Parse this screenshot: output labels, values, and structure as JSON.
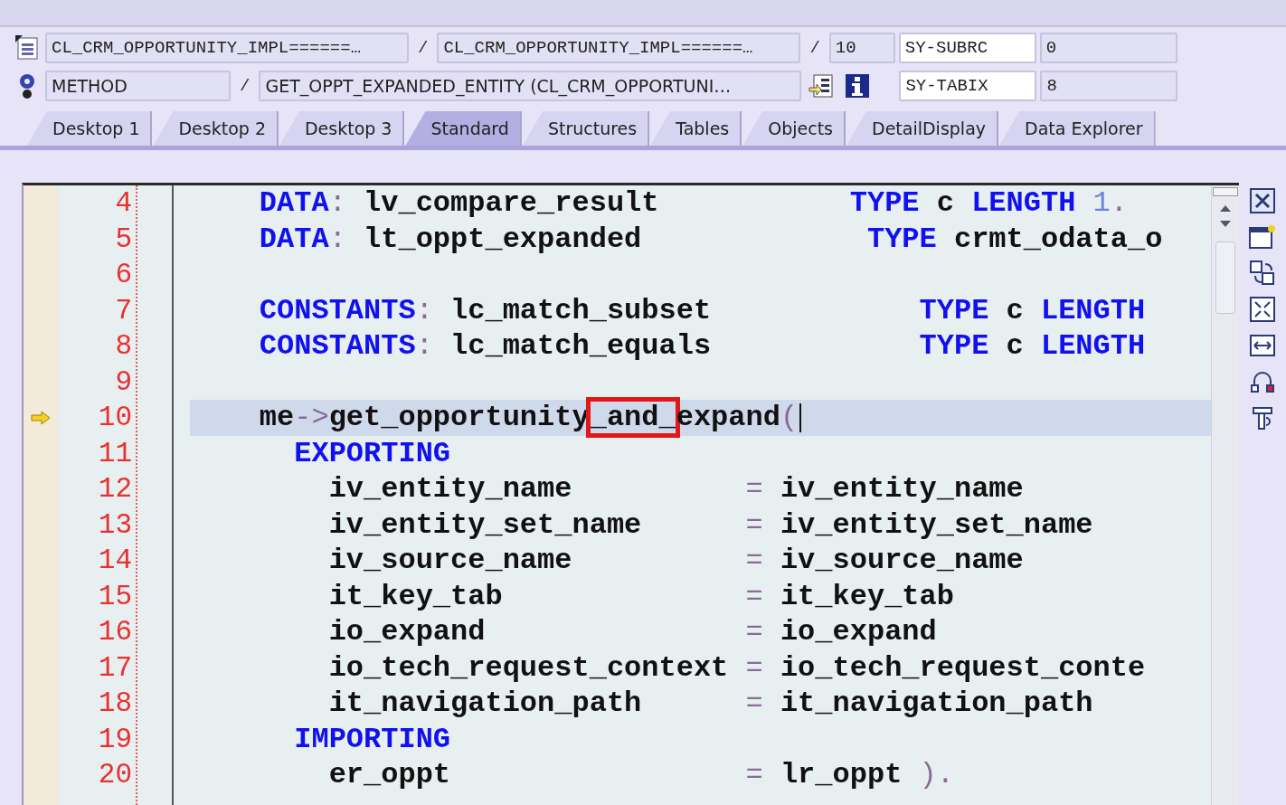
{
  "header_rows": [
    {
      "items": [
        {
          "kind": "mono",
          "value": "CL_CRM_OPPORTUNITY_IMPL======…"
        },
        {
          "kind": "sep",
          "value": "/"
        },
        {
          "kind": "mono",
          "value": "CL_CRM_OPPORTUNITY_IMPL======…"
        },
        {
          "kind": "sep",
          "value": "/"
        },
        {
          "kind": "mono",
          "value": "10"
        },
        {
          "kind": "var",
          "value": "SY-SUBRC"
        },
        {
          "kind": "mono",
          "value": "0"
        }
      ]
    },
    {
      "items": [
        {
          "kind": "sans",
          "value": "METHOD"
        },
        {
          "kind": "sep",
          "value": "/"
        },
        {
          "kind": "sans",
          "value": "GET_OPPT_EXPANDED_ENTITY (CL_CRM_OPPORTUNI…"
        },
        {
          "kind": "tools"
        },
        {
          "kind": "var",
          "value": "SY-TABIX"
        },
        {
          "kind": "mono",
          "value": "8"
        }
      ]
    }
  ],
  "tabs": [
    {
      "label": "Desktop 1",
      "selected": false
    },
    {
      "label": "Desktop 2",
      "selected": false
    },
    {
      "label": "Desktop 3",
      "selected": false
    },
    {
      "label": "Standard",
      "selected": true
    },
    {
      "label": "Structures",
      "selected": false
    },
    {
      "label": "Tables",
      "selected": false
    },
    {
      "label": "Objects",
      "selected": false
    },
    {
      "label": "DetailDisplay",
      "selected": false
    },
    {
      "label": "Data Explorer",
      "selected": false
    }
  ],
  "editor": {
    "lines": [
      {
        "number": "4",
        "current": false,
        "cursor": false,
        "tokens": [
          {
            "kind": "kw",
            "text": "    DATA"
          },
          {
            "kind": "op",
            "text": ":"
          },
          {
            "kind": "id",
            "text": " lv_compare_result           "
          },
          {
            "kind": "kw",
            "text": "TYPE"
          },
          {
            "kind": "id",
            "text": " c "
          },
          {
            "kind": "kw",
            "text": "LENGTH"
          },
          {
            "kind": "num",
            "text": " 1"
          },
          {
            "kind": "op",
            "text": "."
          }
        ]
      },
      {
        "number": "5",
        "current": false,
        "cursor": false,
        "tokens": [
          {
            "kind": "kw",
            "text": "    DATA"
          },
          {
            "kind": "op",
            "text": ":"
          },
          {
            "kind": "id",
            "text": " lt_oppt_expanded             "
          },
          {
            "kind": "kw",
            "text": "TYPE"
          },
          {
            "kind": "id",
            "text": " crmt_odata_o"
          }
        ]
      },
      {
        "number": "6",
        "current": false,
        "cursor": false
      },
      {
        "number": "7",
        "current": false,
        "cursor": false,
        "tokens": [
          {
            "kind": "kw",
            "text": "    CONSTANTS"
          },
          {
            "kind": "op",
            "text": ":"
          },
          {
            "kind": "id",
            "text": " lc_match_subset            "
          },
          {
            "kind": "kw",
            "text": "TYPE"
          },
          {
            "kind": "id",
            "text": " c "
          },
          {
            "kind": "kw",
            "text": "LENGTH"
          }
        ]
      },
      {
        "number": "8",
        "current": false,
        "cursor": false,
        "tokens": [
          {
            "kind": "kw",
            "text": "    CONSTANTS"
          },
          {
            "kind": "op",
            "text": ":"
          },
          {
            "kind": "id",
            "text": " lc_match_equals            "
          },
          {
            "kind": "kw",
            "text": "TYPE"
          },
          {
            "kind": "id",
            "text": " c "
          },
          {
            "kind": "kw",
            "text": "LENGTH"
          }
        ]
      },
      {
        "number": "9",
        "current": false,
        "cursor": false
      },
      {
        "number": "10",
        "current": true,
        "cursor": true,
        "tokens": [
          {
            "kind": "id",
            "text": "    me"
          },
          {
            "kind": "op",
            "text": "->"
          },
          {
            "kind": "id",
            "text": "get_opportunity"
          },
          {
            "kind": "boxed",
            "text": "_and_"
          },
          {
            "kind": "id",
            "text": "expand"
          },
          {
            "kind": "op",
            "text": "("
          }
        ]
      },
      {
        "number": "11",
        "current": false,
        "cursor": false,
        "tokens": [
          {
            "kind": "kw",
            "text": "      EXPORTING"
          }
        ]
      },
      {
        "number": "12",
        "current": false,
        "cursor": false,
        "tokens": [
          {
            "kind": "id",
            "text": "        iv_entity_name          "
          },
          {
            "kind": "op",
            "text": "="
          },
          {
            "kind": "id",
            "text": " iv_entity_name"
          }
        ]
      },
      {
        "number": "13",
        "current": false,
        "cursor": false,
        "tokens": [
          {
            "kind": "id",
            "text": "        iv_entity_set_name      "
          },
          {
            "kind": "op",
            "text": "="
          },
          {
            "kind": "id",
            "text": " iv_entity_set_name"
          }
        ]
      },
      {
        "number": "14",
        "current": false,
        "cursor": false,
        "tokens": [
          {
            "kind": "id",
            "text": "        iv_source_name          "
          },
          {
            "kind": "op",
            "text": "="
          },
          {
            "kind": "id",
            "text": " iv_source_name"
          }
        ]
      },
      {
        "number": "15",
        "current": false,
        "cursor": false,
        "tokens": [
          {
            "kind": "id",
            "text": "        it_key_tab              "
          },
          {
            "kind": "op",
            "text": "="
          },
          {
            "kind": "id",
            "text": " it_key_tab"
          }
        ]
      },
      {
        "number": "16",
        "current": false,
        "cursor": false,
        "tokens": [
          {
            "kind": "id",
            "text": "        io_expand               "
          },
          {
            "kind": "op",
            "text": "="
          },
          {
            "kind": "id",
            "text": " io_expand"
          }
        ]
      },
      {
        "number": "17",
        "current": false,
        "cursor": false,
        "tokens": [
          {
            "kind": "id",
            "text": "        io_tech_request_context "
          },
          {
            "kind": "op",
            "text": "="
          },
          {
            "kind": "id",
            "text": " io_tech_request_conte"
          }
        ]
      },
      {
        "number": "18",
        "current": false,
        "cursor": false,
        "tokens": [
          {
            "kind": "id",
            "text": "        it_navigation_path      "
          },
          {
            "kind": "op",
            "text": "="
          },
          {
            "kind": "id",
            "text": " it_navigation_path"
          }
        ]
      },
      {
        "number": "19",
        "current": false,
        "cursor": false,
        "tokens": [
          {
            "kind": "kw",
            "text": "      IMPORTING"
          }
        ]
      },
      {
        "number": "20",
        "current": false,
        "cursor": false,
        "tokens": [
          {
            "kind": "id",
            "text": "        er_oppt                 "
          },
          {
            "kind": "op",
            "text": "="
          },
          {
            "kind": "id",
            "text": " lr_oppt "
          },
          {
            "kind": "op",
            "text": ")"
          },
          {
            "kind": "op",
            "text": "."
          }
        ]
      }
    ]
  }
}
